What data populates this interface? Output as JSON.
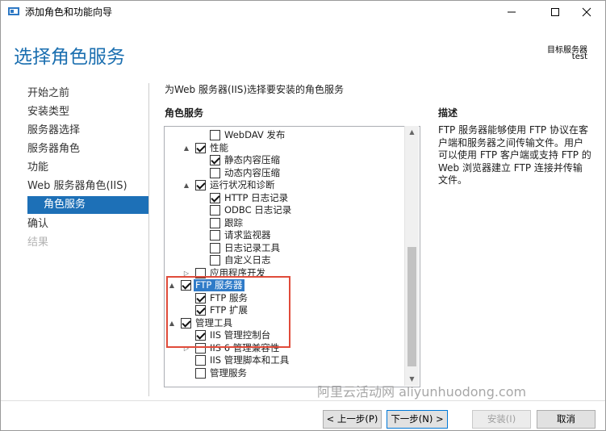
{
  "window": {
    "title": "添加角色和功能向导",
    "controls": {
      "minimize": "minimize-icon",
      "maximize": "maximize-icon",
      "close": "close-icon"
    }
  },
  "header": {
    "page_title": "选择角色服务",
    "target_server_label": "目标服务器",
    "target_server_value": "test"
  },
  "nav": {
    "items": [
      {
        "label": "开始之前",
        "state": "normal"
      },
      {
        "label": "安装类型",
        "state": "normal"
      },
      {
        "label": "服务器选择",
        "state": "normal"
      },
      {
        "label": "服务器角色",
        "state": "normal"
      },
      {
        "label": "功能",
        "state": "normal"
      },
      {
        "label": "Web 服务器角色(IIS)",
        "state": "normal"
      },
      {
        "label": "角色服务",
        "state": "active"
      },
      {
        "label": "确认",
        "state": "normal"
      },
      {
        "label": "结果",
        "state": "disabled"
      }
    ]
  },
  "main": {
    "instruction": "为Web 服务器(IIS)选择要安装的角色服务",
    "roles_heading": "角色服务",
    "tree": [
      {
        "label": "WebDAV 发布",
        "checked": false,
        "expander": "",
        "level": 2
      },
      {
        "label": "性能",
        "checked": true,
        "expander": "▲",
        "level": 1
      },
      {
        "label": "静态内容压缩",
        "checked": true,
        "expander": "",
        "level": 2
      },
      {
        "label": "动态内容压缩",
        "checked": false,
        "expander": "",
        "level": 2
      },
      {
        "label": "运行状况和诊断",
        "checked": true,
        "expander": "▲",
        "level": 1
      },
      {
        "label": "HTTP 日志记录",
        "checked": true,
        "expander": "",
        "level": 2
      },
      {
        "label": "ODBC 日志记录",
        "checked": false,
        "expander": "",
        "level": 2
      },
      {
        "label": "跟踪",
        "checked": false,
        "expander": "",
        "level": 2
      },
      {
        "label": "请求监视器",
        "checked": false,
        "expander": "",
        "level": 2
      },
      {
        "label": "日志记录工具",
        "checked": false,
        "expander": "",
        "level": 2
      },
      {
        "label": "自定义日志",
        "checked": false,
        "expander": "",
        "level": 2
      },
      {
        "label": "应用程序开发",
        "checked": false,
        "expander": "▷",
        "level": 1
      },
      {
        "label": "FTP 服务器",
        "checked": true,
        "expander": "▲",
        "level": 0,
        "selected": true
      },
      {
        "label": "FTP 服务",
        "checked": true,
        "expander": "",
        "level": 1
      },
      {
        "label": "FTP 扩展",
        "checked": true,
        "expander": "",
        "level": 1
      },
      {
        "label": "管理工具",
        "checked": true,
        "expander": "▲",
        "level": 0
      },
      {
        "label": "IIS 管理控制台",
        "checked": true,
        "expander": "",
        "level": 1
      },
      {
        "label": "IIS 6 管理兼容性",
        "checked": false,
        "expander": "▷",
        "level": 1
      },
      {
        "label": "IIS 管理脚本和工具",
        "checked": false,
        "expander": "",
        "level": 1
      },
      {
        "label": "管理服务",
        "checked": false,
        "expander": "",
        "level": 1
      }
    ]
  },
  "description": {
    "heading": "描述",
    "text": "FTP 服务器能够使用 FTP 协议在客户端和服务器之间传输文件。用户可以使用 FTP 客户端或支持 FTP 的 Web 浏览器建立 FTP 连接并传输文件。"
  },
  "footer": {
    "prev": "< 上一步(P)",
    "next": "下一步(N) >",
    "install": "安装(I)",
    "cancel": "取消"
  },
  "watermark": "阿里云活动网 aliyunhuodong.com",
  "colors": {
    "accent": "#1d70b7",
    "title": "#1b6fb0",
    "highlight_border": "#e04b3a"
  }
}
